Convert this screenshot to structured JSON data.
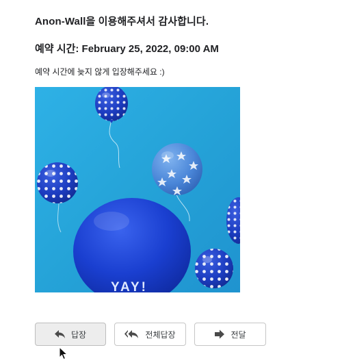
{
  "email": {
    "thanks_heading": "Anon-Wall을 이용해주셔서 감사합니다.",
    "reservation_time": "예약 시간: February 25, 2022, 09:00 AM",
    "notice": "예약 시간에 늦지 않게 입장해주세요 :)",
    "image_text": "YAY!"
  },
  "actions": {
    "reply_label": "답장",
    "reply_all_label": "전체답장",
    "forward_label": "전달"
  },
  "icons": {
    "reply": "reply-icon",
    "reply_all": "reply-all-icon",
    "forward": "forward-icon",
    "cursor": "mouse-pointer-icon"
  },
  "colors": {
    "image_background": "#2aa7da",
    "balloon_blue": "#1a3fcf",
    "hover_button": "#ededed"
  }
}
